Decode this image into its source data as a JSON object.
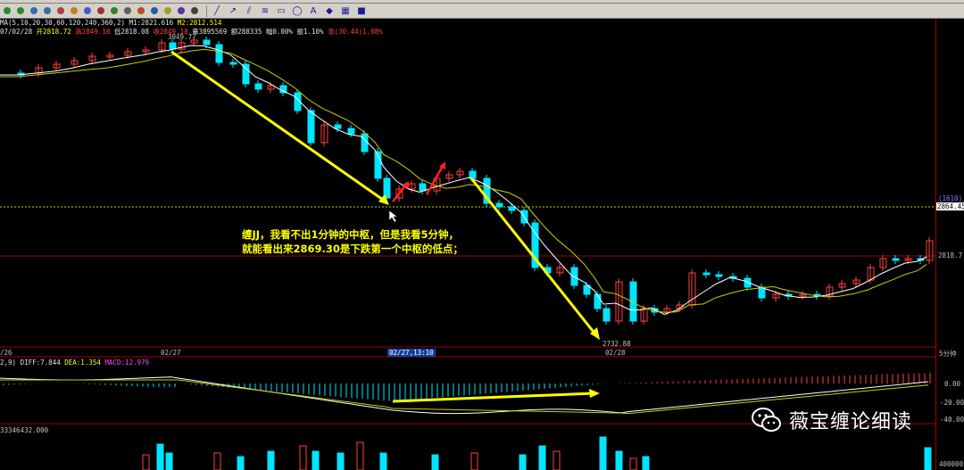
{
  "toolbar": {
    "tools": [
      "line-tool-icon",
      "arrow-tool-icon",
      "rect-tool-icon",
      "ellipse-tool-icon",
      "text-tool-icon",
      "fill-tool-icon",
      "save-tool-icon"
    ]
  },
  "header": {
    "ma_label": "MA(5,10,20,30,60,120,240,360,2)",
    "ma_m1": "M1:2821.616",
    "ma_m2": "M2:2812.514",
    "date_prefix": "07/02/28",
    "open": "开2818.72",
    "high": "高2849.18",
    "low": "低2818.08",
    "close": "收2849.18",
    "volume": "量3895569",
    "amount": "额288335",
    "change_pct": "幅0.00%",
    "amplitude": "振1.10%",
    "rise": "涨(30.44)1.08%"
  },
  "price_axis": {
    "top_label": "3049.77",
    "dotted_level": "2864.45",
    "dotted_tag": "(1610)",
    "current": "2818.7",
    "low_label": "2732.88"
  },
  "date_axis": {
    "d0": "/26",
    "d1": "02/27",
    "cursor": "02/27,13:10",
    "d2": "02/28",
    "period": "5分钟"
  },
  "macd": {
    "label_params": "2,9)",
    "diff": "DIFF:7.844",
    "dea": "DEA:1.354",
    "macd": "MACD:12.979",
    "y1": "0.00",
    "y2": "-20.00",
    "y3": "-40.00"
  },
  "volume": {
    "label": "33346432.000",
    "y1": "400000"
  },
  "annotation": {
    "line1": "缠JJ，我看不出1分钟的中枢，但是我看5分钟，",
    "line2": "就能看出来2869.30是下跌第一个中枢的低点；"
  },
  "watermark": {
    "text": "薇宝缠论细读",
    "icon": "wechat-icon"
  },
  "colors": {
    "up": "#ff4040",
    "down": "#00e5ff",
    "arrow": "#ffff00",
    "red_arrow": "#ff2020",
    "ma_fast": "#ffffff",
    "ma_slow": "#cccc00"
  }
}
